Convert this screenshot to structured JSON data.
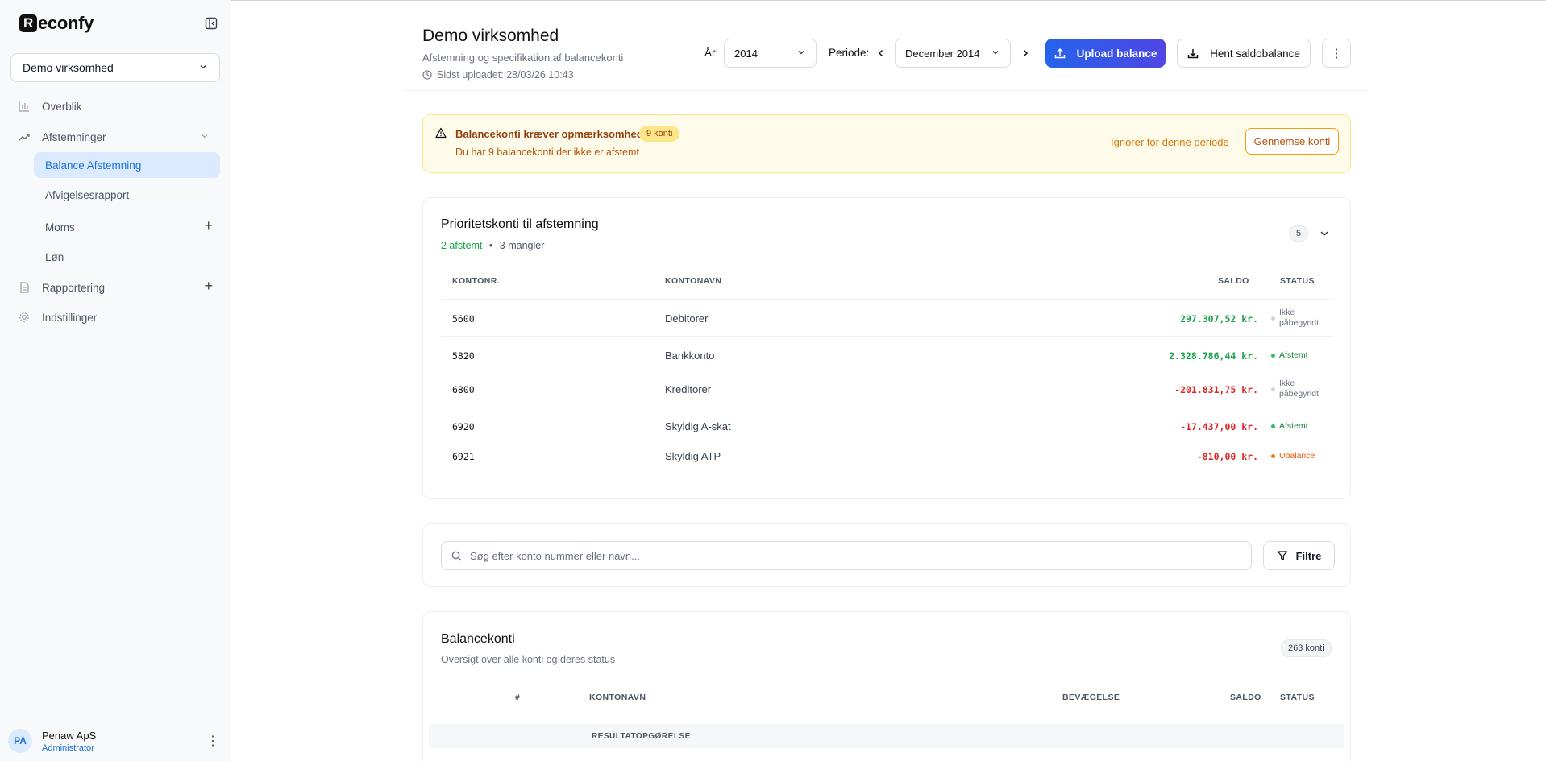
{
  "app": {
    "logo_text": "econfy",
    "logo_letter": "R"
  },
  "sidebar": {
    "company": "Demo virksomhed",
    "items": [
      {
        "label": "Overblik",
        "icon": "bar-chart-icon"
      },
      {
        "label": "Afstemninger",
        "icon": "trending-up-icon"
      },
      {
        "label": "Balance Afstemning",
        "active": true
      },
      {
        "label": "Afvigelsesrapport"
      },
      {
        "label": "Moms"
      },
      {
        "label": "Løn"
      },
      {
        "label": "Rapportering",
        "icon": "document-icon"
      },
      {
        "label": "Indstillinger",
        "icon": "gear-icon"
      }
    ],
    "user": {
      "initials": "PA",
      "name": "Penaw ApS",
      "role": "Administrator"
    }
  },
  "header": {
    "title": "Demo virksomhed",
    "subtitle": "Afstemning og specifikation af balancekonti",
    "last_upload": "Sidst uploadet: 28/03/26 10:43",
    "year_label": "År:",
    "year_value": "2014",
    "period_label": "Periode:",
    "period_value": "December 2014",
    "upload_button": "Upload balance",
    "fetch_button": "Hent saldobalance"
  },
  "alert": {
    "title": "Balancekonti kræver opmærksomhed",
    "badge": "9 konti",
    "text": "Du har 9 balancekonti der ikke er afstemt",
    "ignore": "Ignorer for denne periode",
    "review": "Gennemse konti"
  },
  "priority": {
    "title": "Prioritetskonti til afstemning",
    "reconciled": "2 afstemt",
    "separator": "•",
    "missing": "3 mangler",
    "count": "5",
    "columns": [
      "KONTONR.",
      "KONTONAVN",
      "SALDO",
      "STATUS"
    ],
    "rows": [
      {
        "number": "5600",
        "name": "Debitorer",
        "saldo": "297.307,52 kr.",
        "status": "Ikke påbegyndt"
      },
      {
        "number": "5820",
        "name": "Bankkonto",
        "saldo": "2.328.786,44 kr.",
        "status": "Afstemt"
      },
      {
        "number": "6800",
        "name": "Kreditorer",
        "saldo": "-201.831,75 kr.",
        "status": "Ikke påbegyndt"
      },
      {
        "number": "6920",
        "name": "Skyldig A-skat",
        "saldo": "-17.437,00 kr.",
        "status": "Afstemt"
      },
      {
        "number": "6921",
        "name": "Skyldig ATP",
        "saldo": "-810,00 kr.",
        "status": "Ubalance"
      }
    ]
  },
  "search": {
    "placeholder": "Søg efter konto nummer eller navn...",
    "filter_button": "Filtre"
  },
  "balance": {
    "title": "Balancekonti",
    "subtitle": "Oversigt over alle konti og deres status",
    "count": "263 konti",
    "columns": [
      "#",
      "KONTONAVN",
      "BEVÆGELSE",
      "SALDO",
      "STATUS"
    ],
    "group": "RESULTATOPGØRELSE"
  },
  "colors": {
    "accent": "#1d72d8",
    "positive": "#16a34a",
    "negative": "#dc2626",
    "warning": "#ea580c",
    "neutral": "#d1d5db"
  }
}
